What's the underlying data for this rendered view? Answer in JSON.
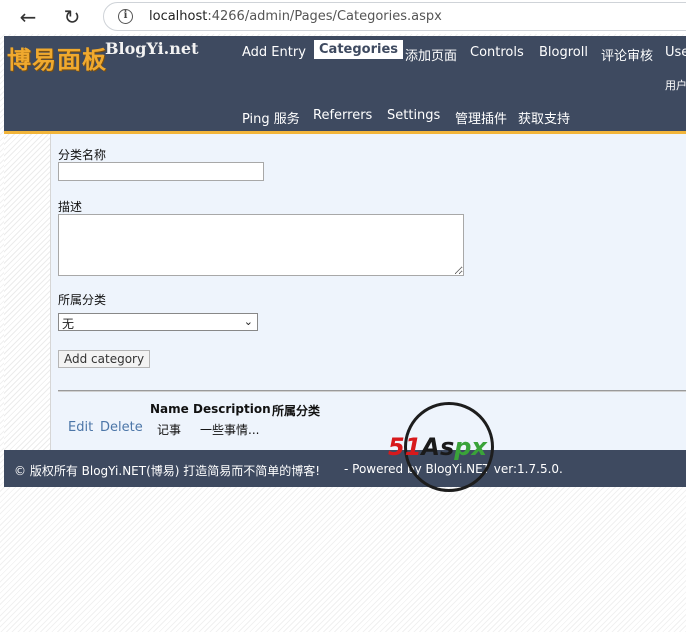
{
  "browser": {
    "url_host": "localhost",
    "url_rest": ":4266/admin/Pages/Categories.aspx"
  },
  "header": {
    "logo_cn": "博易面板",
    "logo_en": "BlogYi.net",
    "menu_row1": [
      "Add Entry",
      "Categories",
      "添加页面",
      "Controls",
      "Blogroll",
      "评论审核",
      "Use"
    ],
    "menu_row1_extra": "用户",
    "menu_row2": [
      "Ping 服务",
      "Referrers",
      "Settings",
      "管理插件",
      "获取支持"
    ],
    "active": "Categories"
  },
  "form": {
    "name_label": "分类名称",
    "name_value": "",
    "description_label": "描述",
    "description_value": "",
    "parent_label": "所属分类",
    "parent_selected": "无",
    "add_button": "Add category"
  },
  "table": {
    "headers": [
      "Name",
      "Description",
      "所属分类"
    ],
    "rows": [
      {
        "edit": "Edit",
        "delete": "Delete",
        "name": "记事",
        "description": "一些事情..."
      }
    ]
  },
  "footer": {
    "copyright": "© 版权所有 BlogYi.NET(博易) 打造简易而不简单的博客!",
    "powered": "- Powered by BlogYi.NET ver:1.7.5.0."
  },
  "watermark": {
    "part1": "51",
    "part2": "As",
    "part3": "px"
  }
}
